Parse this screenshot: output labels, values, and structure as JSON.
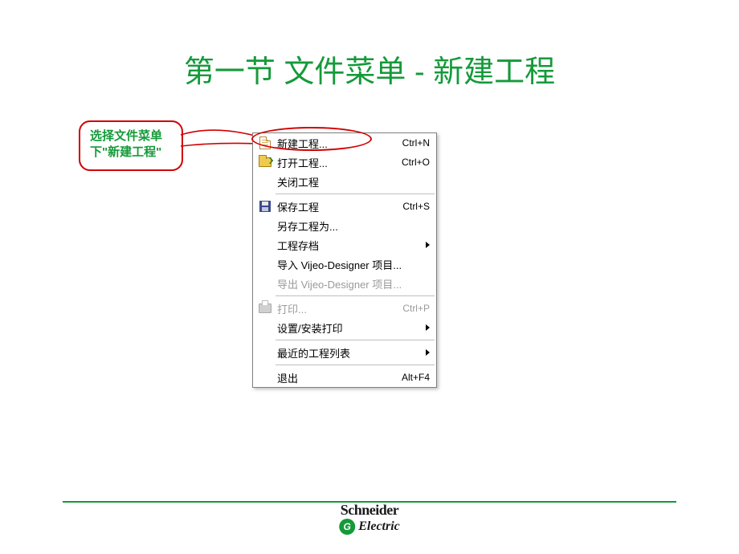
{
  "title": "第一节 文件菜单 - 新建工程",
  "callout": {
    "line1": "选择文件菜单",
    "line2": "下\"新建工程\""
  },
  "menu": {
    "items": [
      {
        "icon": "new-doc-icon",
        "label": "新建工程...",
        "shortcut": "Ctrl+N",
        "disabled": false
      },
      {
        "icon": "open-folder-icon",
        "label": "打开工程...",
        "shortcut": "Ctrl+O",
        "disabled": false
      },
      {
        "icon": "",
        "label": "关闭工程",
        "shortcut": "",
        "disabled": false
      },
      {
        "sep": true
      },
      {
        "icon": "save-icon",
        "label": "保存工程",
        "shortcut": "Ctrl+S",
        "disabled": false
      },
      {
        "icon": "",
        "label": "另存工程为...",
        "shortcut": "",
        "disabled": false
      },
      {
        "icon": "",
        "label": "工程存档",
        "submenu": true,
        "disabled": false
      },
      {
        "icon": "",
        "label": "导入 Vijeo-Designer 项目...",
        "shortcut": "",
        "disabled": false
      },
      {
        "icon": "",
        "label": "导出 Vijeo-Designer 项目...",
        "shortcut": "",
        "disabled": true
      },
      {
        "sep": true
      },
      {
        "icon": "print-icon",
        "label": "打印...",
        "shortcut": "Ctrl+P",
        "disabled": true
      },
      {
        "icon": "",
        "label": "设置/安装打印",
        "submenu": true,
        "disabled": false
      },
      {
        "sep": true
      },
      {
        "icon": "",
        "label": "最近的工程列表",
        "submenu": true,
        "disabled": false
      },
      {
        "sep": true
      },
      {
        "icon": "",
        "label": "退出",
        "shortcut": "Alt+F4",
        "disabled": false
      }
    ]
  },
  "footer": {
    "brand_top": "Schneider",
    "brand_badge": "G",
    "brand_bottom": "Electric"
  }
}
